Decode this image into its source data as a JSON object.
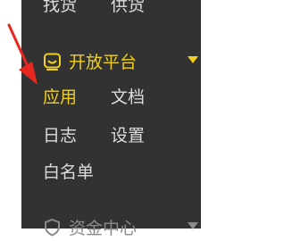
{
  "menu": {
    "top_links": [
      "找货",
      "供货"
    ],
    "open_platform": {
      "title": "开放平台",
      "icon": "smile-box-icon",
      "items": [
        "应用",
        "文档",
        "日志",
        "设置",
        "白名单"
      ],
      "active_item": "应用"
    },
    "funds_center": {
      "title": "资金中心",
      "icon": "shield-icon"
    }
  },
  "colors": {
    "sidebar_bg": "#323232",
    "active": "#f0cf1e",
    "text": "#dcdcdc",
    "muted": "#8a8a8a",
    "annotation_arrow": "#e8281e"
  }
}
